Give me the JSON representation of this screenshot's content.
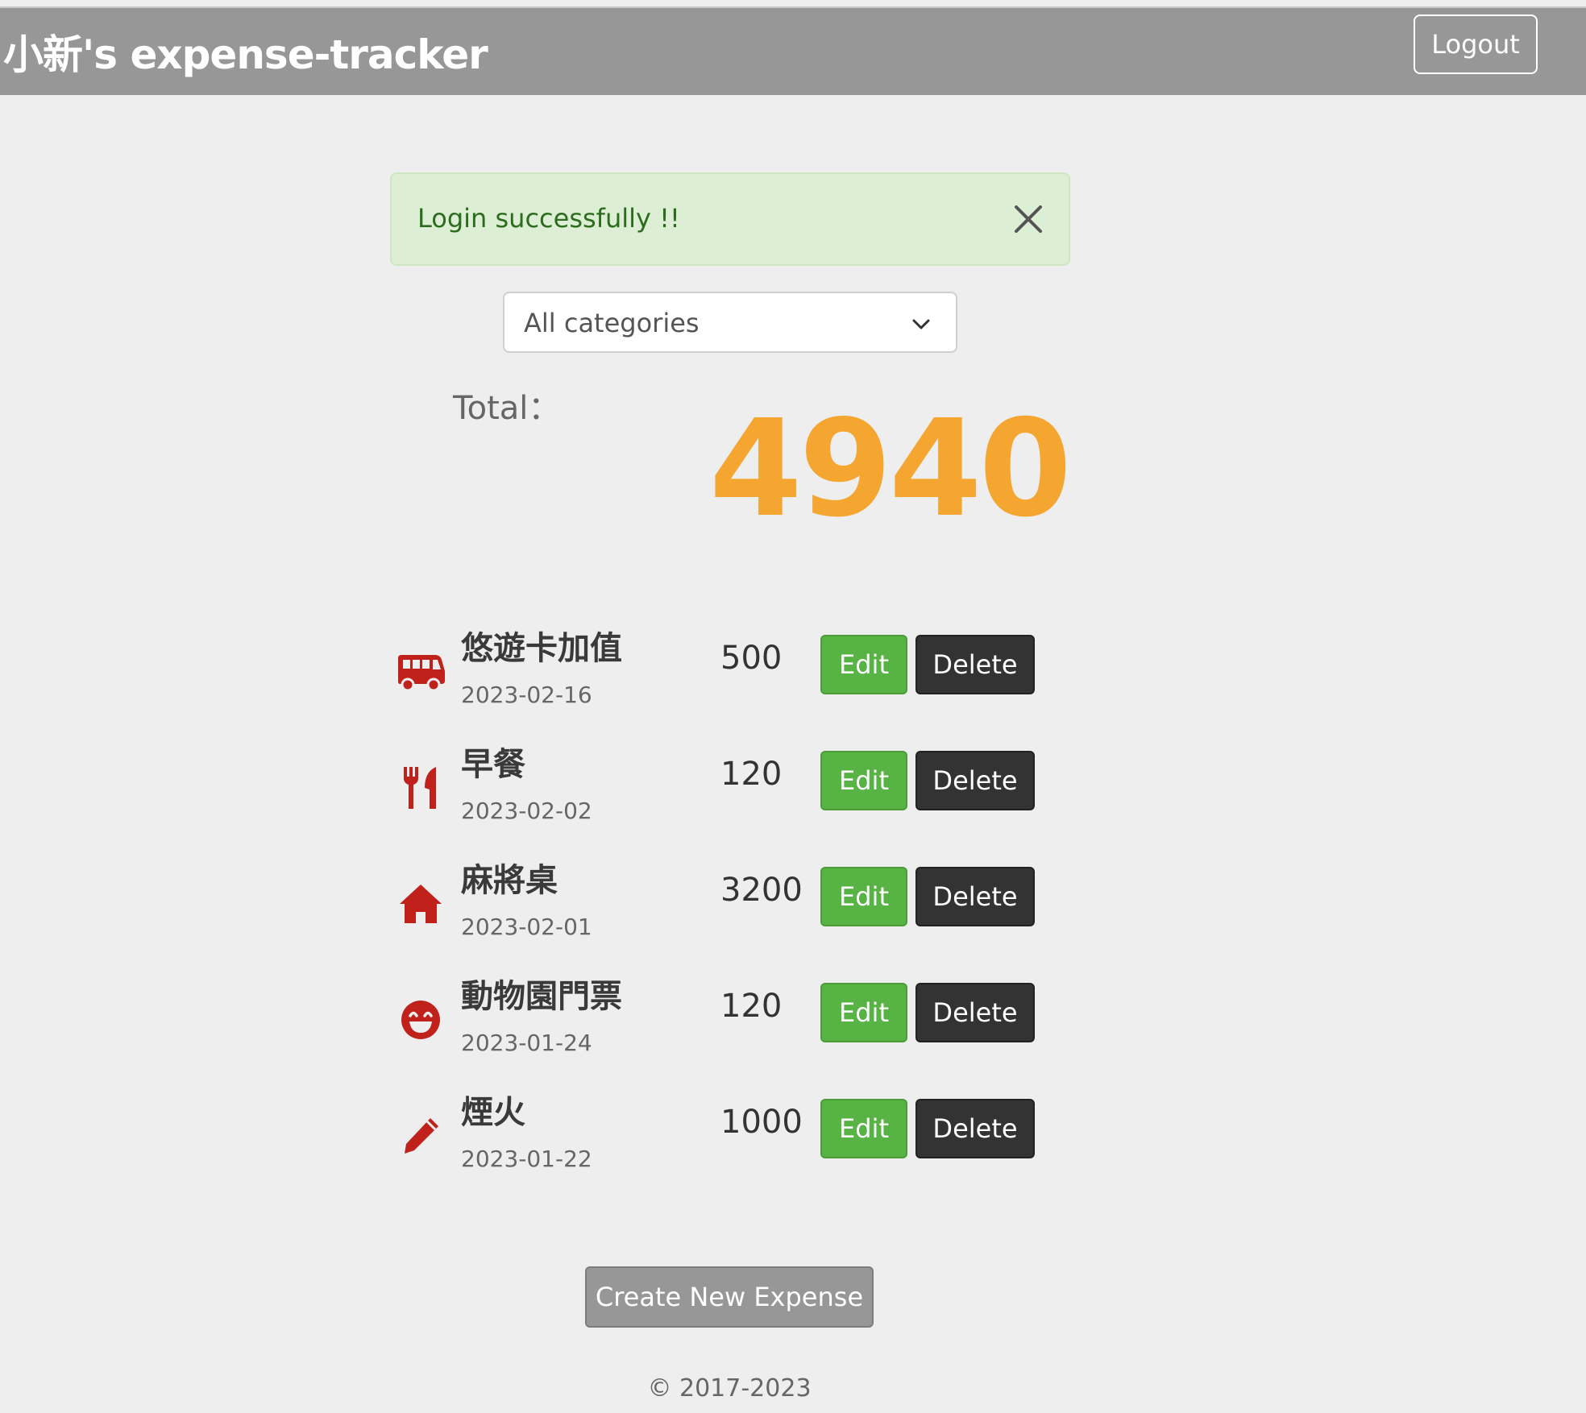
{
  "navbar": {
    "brand": "小新's expense-tracker",
    "logout_label": "Logout"
  },
  "alert": {
    "message": "Login successfully !!"
  },
  "filter": {
    "selected": "All categories"
  },
  "total": {
    "label": "Total：",
    "value": "4940"
  },
  "expenses": [
    {
      "name": "悠遊卡加值",
      "date": "2023-02-16",
      "amount": "500",
      "category_icon": "bus-icon",
      "edit_label": "Edit",
      "delete_label": "Delete"
    },
    {
      "name": "早餐",
      "date": "2023-02-02",
      "amount": "120",
      "category_icon": "utensils-icon",
      "edit_label": "Edit",
      "delete_label": "Delete"
    },
    {
      "name": "麻將桌",
      "date": "2023-02-01",
      "amount": "3200",
      "category_icon": "home-icon",
      "edit_label": "Edit",
      "delete_label": "Delete"
    },
    {
      "name": "動物園門票",
      "date": "2023-01-24",
      "amount": "120",
      "category_icon": "smile-icon",
      "edit_label": "Edit",
      "delete_label": "Delete"
    },
    {
      "name": "煙火",
      "date": "2023-01-22",
      "amount": "1000",
      "category_icon": "pencil-icon",
      "edit_label": "Edit",
      "delete_label": "Delete"
    }
  ],
  "create_label": "Create New Expense",
  "footer": "© 2017-2023",
  "colors": {
    "navbar": "#979797",
    "total": "#f5a631",
    "edit": "#58b345",
    "delete": "#333333",
    "icon": "#c0211b",
    "alert_bg": "#dcefd4"
  }
}
